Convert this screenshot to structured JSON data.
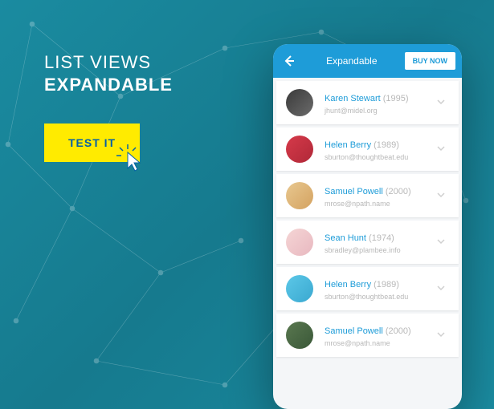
{
  "promo": {
    "line1": "LIST VIEWS",
    "line2": "EXPANDABLE",
    "cta": "TEST IT"
  },
  "app": {
    "header_title": "Expandable",
    "buy_label": "BUY NOW"
  },
  "colors": {
    "accent": "#1e9cd8",
    "cta_bg": "#ffeb00"
  },
  "contacts": [
    {
      "name": "Karen Stewart",
      "year": "(1995)",
      "email": "jhunt@midel.org",
      "avatar_bg": "linear-gradient(135deg,#3a3a3a,#6b6b6b)"
    },
    {
      "name": "Helen Berry",
      "year": "(1989)",
      "email": "sburton@thoughtbeat.edu",
      "avatar_bg": "linear-gradient(135deg,#d63a4a,#b02838)"
    },
    {
      "name": "Samuel Powell",
      "year": "(2000)",
      "email": "mrose@npath.name",
      "avatar_bg": "linear-gradient(135deg,#e8c890,#d4a260)"
    },
    {
      "name": "Sean Hunt",
      "year": "(1974)",
      "email": "sbradley@plambee.info",
      "avatar_bg": "linear-gradient(135deg,#f5d5d5,#e8b8c0)"
    },
    {
      "name": "Helen Berry",
      "year": "(1989)",
      "email": "sburton@thoughtbeat.edu",
      "avatar_bg": "linear-gradient(135deg,#5cc8e8,#3aa8d0)"
    },
    {
      "name": "Samuel Powell",
      "year": "(2000)",
      "email": "mrose@npath.name",
      "avatar_bg": "linear-gradient(135deg,#5a7850,#3a5838)"
    }
  ]
}
